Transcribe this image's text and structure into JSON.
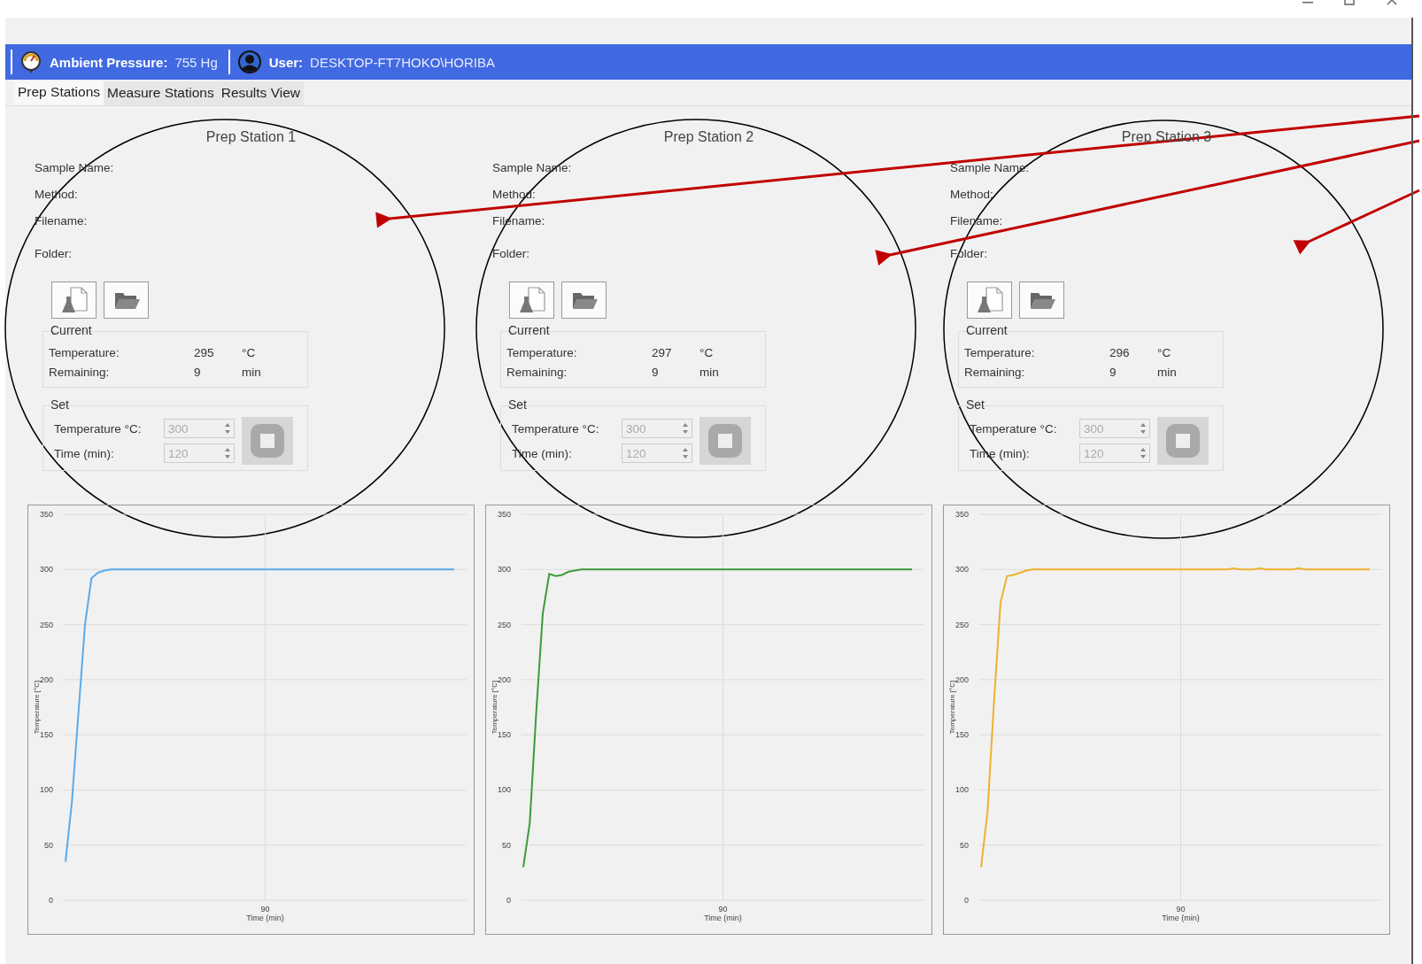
{
  "status_bar": {
    "pressure_label": "Ambient Pressure:",
    "pressure_value": "755 Hg",
    "user_label": "User:",
    "user_value": "DESKTOP-FT7HOKO\\HORIBA"
  },
  "tabs": [
    {
      "label": "Prep Stations",
      "selected": true
    },
    {
      "label": "Measure Stations",
      "selected": false
    },
    {
      "label": "Results View",
      "selected": false
    }
  ],
  "stations": [
    {
      "title": "Prep Station 1",
      "fields": [
        "Sample Name:",
        "Method:",
        "Filename:",
        "Folder:"
      ],
      "current": {
        "legend": "Current",
        "rows": [
          {
            "label": "Temperature:",
            "value": "295",
            "unit": "°C"
          },
          {
            "label": "Remaining:",
            "value": "9",
            "unit": "min"
          }
        ]
      },
      "set": {
        "legend": "Set",
        "rows": [
          {
            "label": "Temperature °C:",
            "value": "300",
            "disabled": true
          },
          {
            "label": "Time (min):",
            "value": "120",
            "disabled": true
          }
        ],
        "stop_disabled": true
      },
      "chart_data": {
        "type": "line",
        "xlabel": "Time (min)",
        "ylabel": "Temperature [°C]",
        "grid": true,
        "series": [
          {
            "color": "#5aaaea",
            "values": [
              35,
              90,
              170,
              250,
              292,
              297,
              299,
              300,
              300,
              300,
              300,
              300,
              300,
              300,
              300,
              300,
              300,
              300,
              300,
              300,
              300,
              300,
              300,
              300,
              300,
              300,
              300,
              300,
              300,
              300,
              300,
              300,
              300,
              300,
              300,
              300,
              300,
              300,
              300,
              300,
              300,
              300,
              300,
              300,
              300,
              300,
              300,
              300,
              300,
              300,
              300,
              300,
              300,
              300,
              300,
              300,
              300,
              300,
              300,
              300,
              300
            ]
          }
        ],
        "ylim": [
          0,
          350
        ],
        "yticks": [
          0,
          50,
          100,
          150,
          200,
          250,
          300,
          350
        ],
        "annotations": [
          "90"
        ]
      }
    },
    {
      "title": "Prep Station 2",
      "fields": [
        "Sample Name:",
        "Method:",
        "Filename:",
        "Folder:"
      ],
      "current": {
        "legend": "Current",
        "rows": [
          {
            "label": "Temperature:",
            "value": "297",
            "unit": "°C"
          },
          {
            "label": "Remaining:",
            "value": "9",
            "unit": "min"
          }
        ]
      },
      "set": {
        "legend": "Set",
        "rows": [
          {
            "label": "Temperature °C:",
            "value": "300",
            "disabled": true
          },
          {
            "label": "Time (min):",
            "value": "120",
            "disabled": true
          }
        ],
        "stop_disabled": true
      },
      "chart_data": {
        "type": "line",
        "xlabel": "Time (min)",
        "ylabel": "Temperature [°C]",
        "grid": true,
        "series": [
          {
            "color": "#3c9a3c",
            "values": [
              30,
              70,
              170,
              260,
              296,
              294,
              295,
              298,
              299,
              300,
              300,
              300,
              300,
              300,
              300,
              300,
              300,
              300,
              300,
              300,
              300,
              300,
              300,
              300,
              300,
              300,
              300,
              300,
              300,
              300,
              300,
              300,
              300,
              300,
              300,
              300,
              300,
              300,
              300,
              300,
              300,
              300,
              300,
              300,
              300,
              300,
              300,
              300,
              300,
              300,
              300,
              300,
              300,
              300,
              300,
              300,
              300,
              300,
              300,
              300,
              300
            ]
          }
        ],
        "ylim": [
          0,
          350
        ],
        "yticks": [
          0,
          50,
          100,
          150,
          200,
          250,
          300,
          350
        ],
        "annotations": [
          "90"
        ]
      }
    },
    {
      "title": "Prep Station 3",
      "fields": [
        "Sample Name:",
        "Method:",
        "Filename:",
        "Folder:"
      ],
      "current": {
        "legend": "Current",
        "rows": [
          {
            "label": "Temperature:",
            "value": "296",
            "unit": "°C"
          },
          {
            "label": "Remaining:",
            "value": "9",
            "unit": "min"
          }
        ]
      },
      "set": {
        "legend": "Set",
        "rows": [
          {
            "label": "Temperature °C:",
            "value": "300",
            "disabled": true
          },
          {
            "label": "Time (min):",
            "value": "120",
            "disabled": true
          }
        ],
        "stop_disabled": true
      },
      "chart_data": {
        "type": "line",
        "xlabel": "Time (min)",
        "ylabel": "Temperature [°C]",
        "grid": true,
        "series": [
          {
            "color": "#f0b030",
            "values": [
              30,
              80,
              180,
              270,
              294,
              295,
              297,
              299,
              300,
              300,
              300,
              300,
              300,
              300,
              300,
              300,
              300,
              300,
              300,
              300,
              300,
              300,
              300,
              300,
              300,
              300,
              300,
              300,
              300,
              300,
              300,
              300,
              300,
              300,
              300,
              300,
              300,
              300,
              300,
              301,
              300,
              300,
              300,
              301,
              300,
              300,
              300,
              300,
              300,
              301,
              300,
              300,
              300,
              300,
              300,
              300,
              300,
              300,
              300,
              300,
              300
            ]
          }
        ],
        "ylim": [
          0,
          350
        ],
        "yticks": [
          0,
          50,
          100,
          150,
          200,
          250,
          300,
          350
        ],
        "annotations": [
          "90"
        ]
      }
    }
  ]
}
